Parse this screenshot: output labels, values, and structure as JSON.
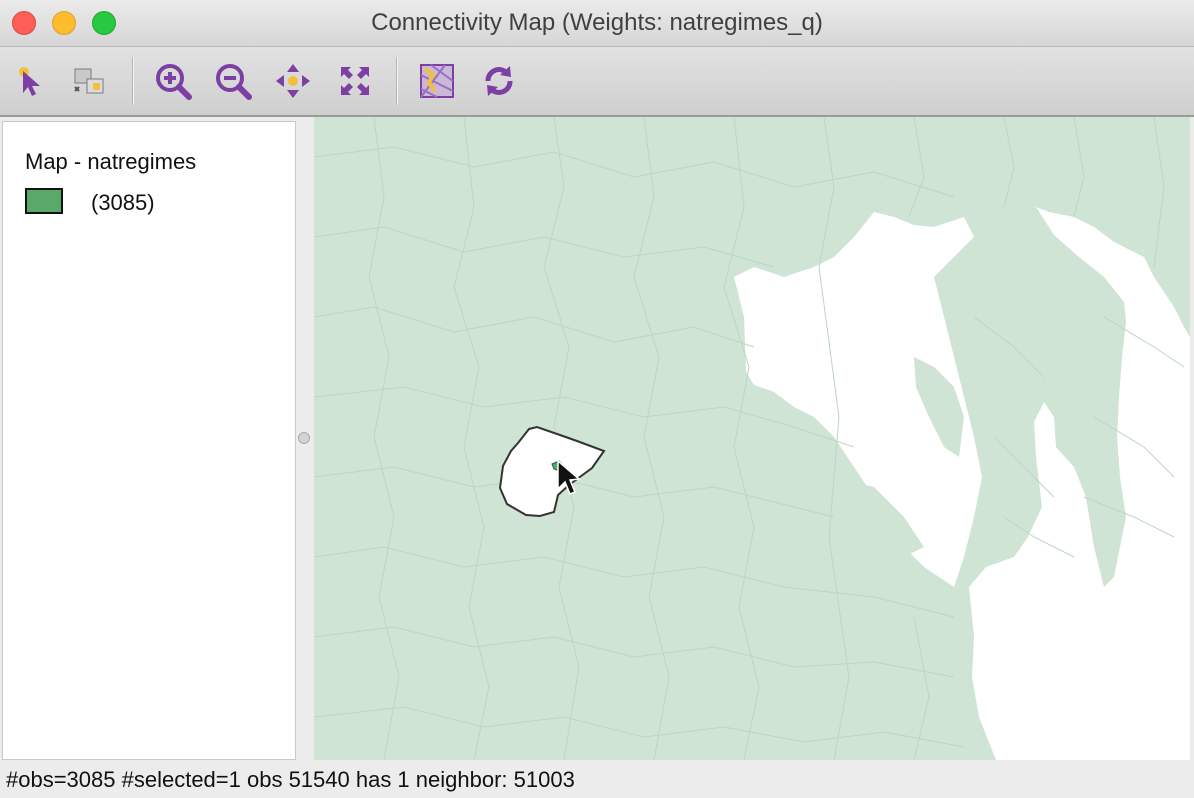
{
  "window": {
    "title": "Connectivity Map (Weights: natregimes_q)"
  },
  "toolbar": {
    "tools": [
      {
        "name": "select-tool-icon"
      },
      {
        "name": "selection-mode-icon"
      },
      {
        "name": "zoom-in-icon"
      },
      {
        "name": "zoom-out-icon"
      },
      {
        "name": "pan-icon"
      },
      {
        "name": "fit-extent-icon"
      },
      {
        "name": "basemap-icon"
      },
      {
        "name": "refresh-icon"
      }
    ]
  },
  "legend": {
    "title": "Map - natregimes",
    "category_count": "(3085)",
    "category_color": "#59a96b"
  },
  "map": {
    "land_color": "#cfe4d4",
    "water_color": "#ffffff",
    "highlight_color": "#ffffff"
  },
  "status_bar": {
    "text": "#obs=3085 #selected=1  obs 51540 has 1 neighbor: 51003"
  }
}
